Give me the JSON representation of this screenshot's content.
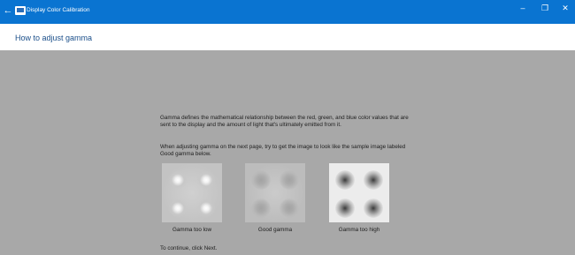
{
  "window": {
    "title": "Display Color Calibration",
    "back_glyph": "←",
    "minimize_glyph": "–",
    "maximize_glyph": "❐",
    "close_glyph": "✕"
  },
  "header": {
    "title": "How to adjust gamma"
  },
  "content": {
    "paragraph1": "Gamma defines the mathematical relationship between the red, green, and blue color values that are sent to the display and the amount of light that's ultimately emitted from it.",
    "paragraph2": "When adjusting gamma on the next page, try to get the image to look like the sample image labeled Good gamma below.",
    "paragraph3": "To continue, click Next."
  },
  "samples": [
    {
      "caption": "Gamma too low"
    },
    {
      "caption": "Good gamma"
    },
    {
      "caption": "Gamma too high"
    }
  ],
  "colors": {
    "titlebar": "#0a74d1",
    "background": "#a8a8a8",
    "header_text": "#1b4f8a"
  }
}
